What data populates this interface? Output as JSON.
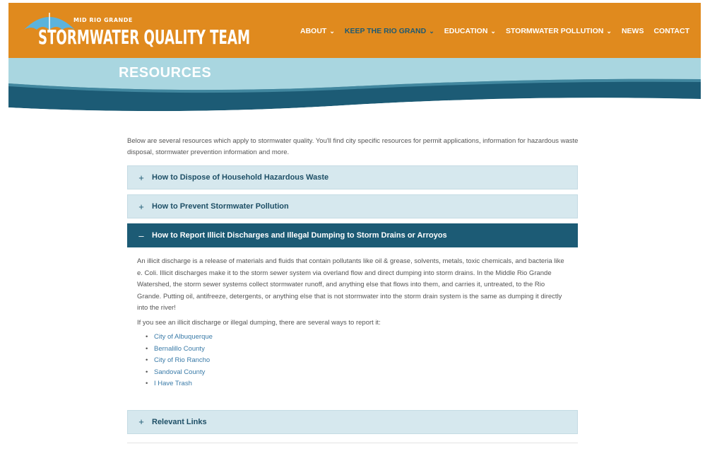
{
  "logo": {
    "tagline": "MID RIO GRANDE",
    "wordmark": "STORMWATER QUALITY TEAM"
  },
  "nav": [
    {
      "label": "ABOUT",
      "dropdown": true,
      "active": false
    },
    {
      "label": "KEEP THE RIO GRAND",
      "dropdown": true,
      "active": true
    },
    {
      "label": "EDUCATION",
      "dropdown": true,
      "active": false
    },
    {
      "label": "STORMWATER POLLUTION",
      "dropdown": true,
      "active": false
    },
    {
      "label": "NEWS",
      "dropdown": false,
      "active": false
    },
    {
      "label": "CONTACT",
      "dropdown": false,
      "active": false
    }
  ],
  "banner": {
    "title": "RESOURCES"
  },
  "intro": "Below are several resources which apply to stormwater quality. You'll find city specific resources for permit applications, information for hazardous waste disposal, stormwater prevention information and more.",
  "accordion": [
    {
      "title": "How to Dispose of Household Hazardous Waste",
      "sign": "+"
    },
    {
      "title": "How to Prevent Stormwater Pollution",
      "sign": "+"
    },
    {
      "title": "How to Report Illicit Discharges and Illegal Dumping to Storm Drains or Arroyos",
      "sign": "–",
      "body": "An illicit discharge is a release of materials and fluids that contain pollutants like oil & grease, solvents, metals, toxic chemicals, and bacteria like e. Coli. Illicit discharges make it to the storm sewer system via overland flow and direct dumping into storm drains. In the Middle Rio Grande Watershed, the storm sewer systems collect stormwater runoff, and anything else that flows into them, and carries it, untreated, to the Rio Grande.  Putting oil, antifreeze, detergents, or anything else that is not stormwater into the storm drain system is the same as dumping it directly into the river!",
      "report_intro": "If you see an illicit discharge or illegal dumping, there are several ways to report it:",
      "links": [
        "City of Albuquerque",
        "Bernalillo County",
        "City of Rio Rancho",
        "Sandoval County",
        "I Have Trash"
      ]
    },
    {
      "title": "Relevant Links",
      "sign": "+"
    }
  ],
  "colors": {
    "header": "#e08a1e",
    "banner_light": "#a9d6e0",
    "banner_dark": "#1c5b75",
    "accordion_bg": "#d6e8ee",
    "link": "#3a7ba8"
  }
}
